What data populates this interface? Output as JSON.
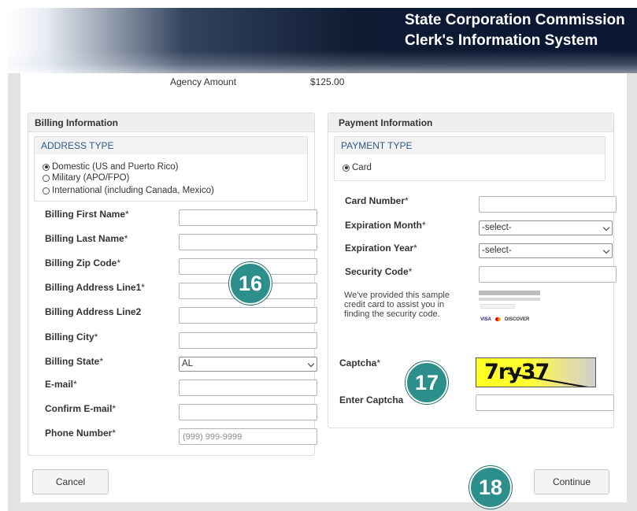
{
  "header": {
    "title_line1": "State Corporation Commission",
    "title_line2": "Clerk's Information System"
  },
  "summary": {
    "agency_amount_label": "Agency Amount",
    "agency_amount_value": "$125.00"
  },
  "billing": {
    "panel_title": "Billing Information",
    "address_type_title": "ADDRESS TYPE",
    "address_options": [
      {
        "label": "Domestic (US and Puerto Rico)",
        "checked": true
      },
      {
        "label": "Military (APO/FPO)",
        "checked": false
      },
      {
        "label": "International (including Canada, Mexico)",
        "checked": false
      }
    ],
    "fields": {
      "first_name": {
        "label": "Billing First Name",
        "required": "*"
      },
      "last_name": {
        "label": "Billing Last Name",
        "required": "*"
      },
      "zip": {
        "label": "Billing Zip Code",
        "required": "*"
      },
      "address1": {
        "label": "Billing Address Line1",
        "required": "*"
      },
      "address2": {
        "label": "Billing Address Line2",
        "required": ""
      },
      "city": {
        "label": "Billing City",
        "required": "*"
      },
      "state": {
        "label": "Billing State",
        "required": "*",
        "value": "AL"
      },
      "email": {
        "label": "E-mail",
        "required": "*"
      },
      "confirm_email": {
        "label": "Confirm E-mail",
        "required": "*"
      },
      "phone": {
        "label": "Phone Number",
        "required": "*",
        "placeholder": "(999) 999-9999"
      }
    }
  },
  "payment": {
    "panel_title": "Payment Information",
    "payment_type_title": "PAYMENT TYPE",
    "payment_option": {
      "label": "Card",
      "checked": true
    },
    "card_number_label": "Card Number",
    "expiration_month_label": "Expiration Month",
    "expiration_month_value": "-select-",
    "expiration_year_label": "Expiration Year",
    "expiration_year_value": "-select-",
    "security_code_label": "Security Code",
    "required_mark": "*",
    "security_note": "We've provided this sample credit card to assist you in finding the security code.",
    "card_logos": {
      "visa": "VISA",
      "discover": "DISCOVER"
    },
    "captcha_label": "Captcha",
    "captcha_text": "7ry37",
    "enter_captcha_label": "Enter Captcha"
  },
  "actions": {
    "cancel_label": "Cancel",
    "continue_label": "Continue"
  },
  "callouts": {
    "badge_16": "16",
    "badge_17": "17",
    "badge_18": "18",
    "color": "#2d8f8b"
  }
}
